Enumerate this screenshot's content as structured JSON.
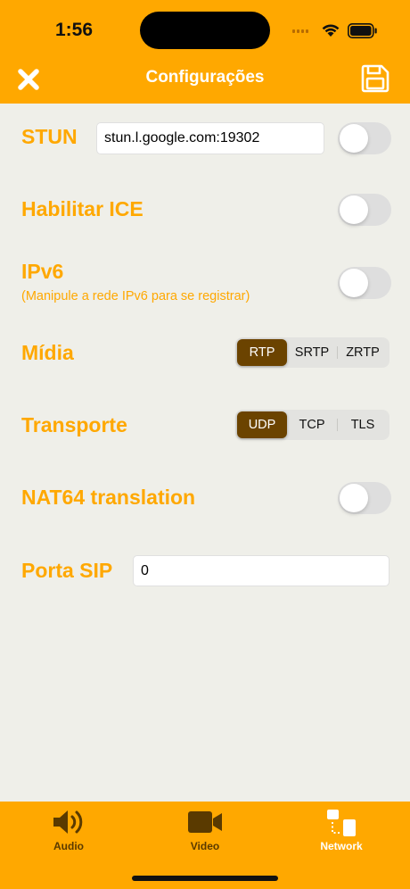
{
  "status_bar": {
    "time": "1:56"
  },
  "header": {
    "title": "Configurações",
    "close_icon": "close-icon",
    "save_icon": "save-icon"
  },
  "settings": {
    "stun": {
      "label": "STUN",
      "value": "stun.l.google.com:19302",
      "enabled": false
    },
    "ice": {
      "label": "Habilitar ICE",
      "enabled": false
    },
    "ipv6": {
      "label": "IPv6",
      "subtitle": "(Manipule a rede IPv6 para se registrar)",
      "enabled": false
    },
    "media": {
      "label": "Mídia",
      "options": [
        "RTP",
        "SRTP",
        "ZRTP"
      ],
      "selected": "RTP"
    },
    "transport": {
      "label": "Transporte",
      "options": [
        "UDP",
        "TCP",
        "TLS"
      ],
      "selected": "UDP"
    },
    "nat64": {
      "label": "NAT64 translation",
      "enabled": false
    },
    "sip_port": {
      "label": "Porta SIP",
      "value": "0"
    }
  },
  "tabs": [
    {
      "label": "Audio",
      "icon": "speaker-icon",
      "active": false
    },
    {
      "label": "Video",
      "icon": "video-camera-icon",
      "active": false
    },
    {
      "label": "Network",
      "icon": "network-icon",
      "active": true
    }
  ],
  "colors": {
    "accent": "#ffa800",
    "background": "#efefe9",
    "segment_active": "#6b4300",
    "tab_inactive": "#5a3a00",
    "tab_active": "#ffffff"
  }
}
